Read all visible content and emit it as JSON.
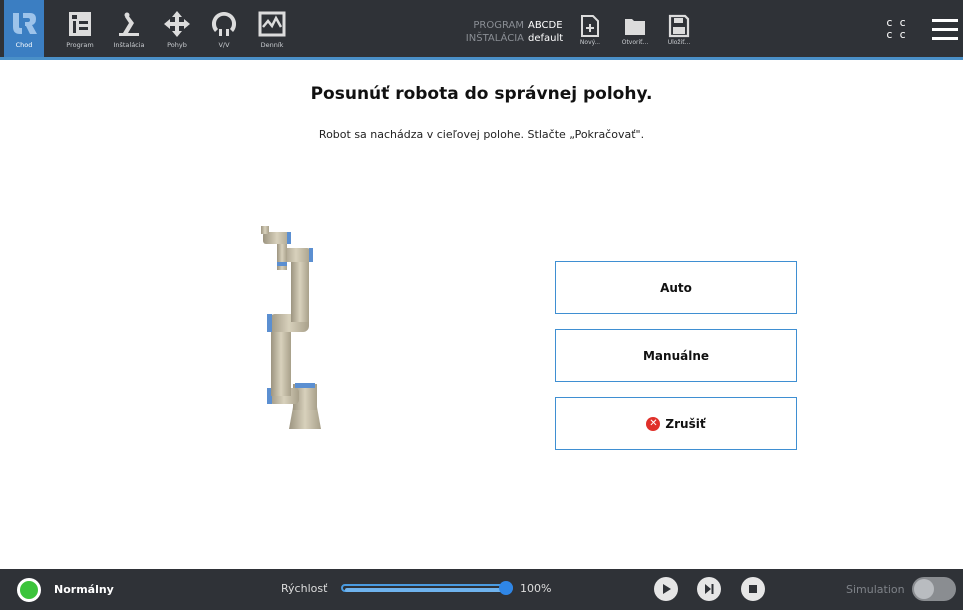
{
  "nav": {
    "items": [
      {
        "label": "Chod",
        "icon": "ur-logo-icon"
      },
      {
        "label": "Program",
        "icon": "program-icon"
      },
      {
        "label": "Inštalácia",
        "icon": "installation-icon"
      },
      {
        "label": "Pohyb",
        "icon": "move-icon"
      },
      {
        "label": "V/V",
        "icon": "io-icon"
      },
      {
        "label": "Denník",
        "icon": "log-icon"
      }
    ],
    "active": "Chod"
  },
  "program_info": {
    "program_key": "PROGRAM",
    "program_value": "ABCDE",
    "installation_key": "INŠTALÁCIA",
    "installation_value": "default"
  },
  "file_buttons": [
    {
      "label": "Nový...",
      "icon": "new-file-icon"
    },
    {
      "label": "Otvoriť...",
      "icon": "folder-icon"
    },
    {
      "label": "Uložiť...",
      "icon": "save-icon"
    }
  ],
  "cc": {
    "line1": "c c",
    "line2": "c c"
  },
  "main": {
    "title": "Posunúť robota do správnej polohy.",
    "subtitle": "Robot sa nachádza v cieľovej polohe. Stlačte „Pokračovať\".",
    "buttons": {
      "auto": "Auto",
      "manual": "Manuálne",
      "cancel": "Zrušiť"
    }
  },
  "bottom": {
    "status": "Normálny",
    "status_color": "#3cc43c",
    "speed_label": "Rýchlosť",
    "speed_value": "100%",
    "speed_fraction": 1.0,
    "simulation_label": "Simulation",
    "simulation_on": false
  },
  "colors": {
    "accent": "#3b7ec2",
    "bar_bg": "#2f3237",
    "button_border": "#3f8fd2",
    "cancel_red": "#e0302a"
  }
}
